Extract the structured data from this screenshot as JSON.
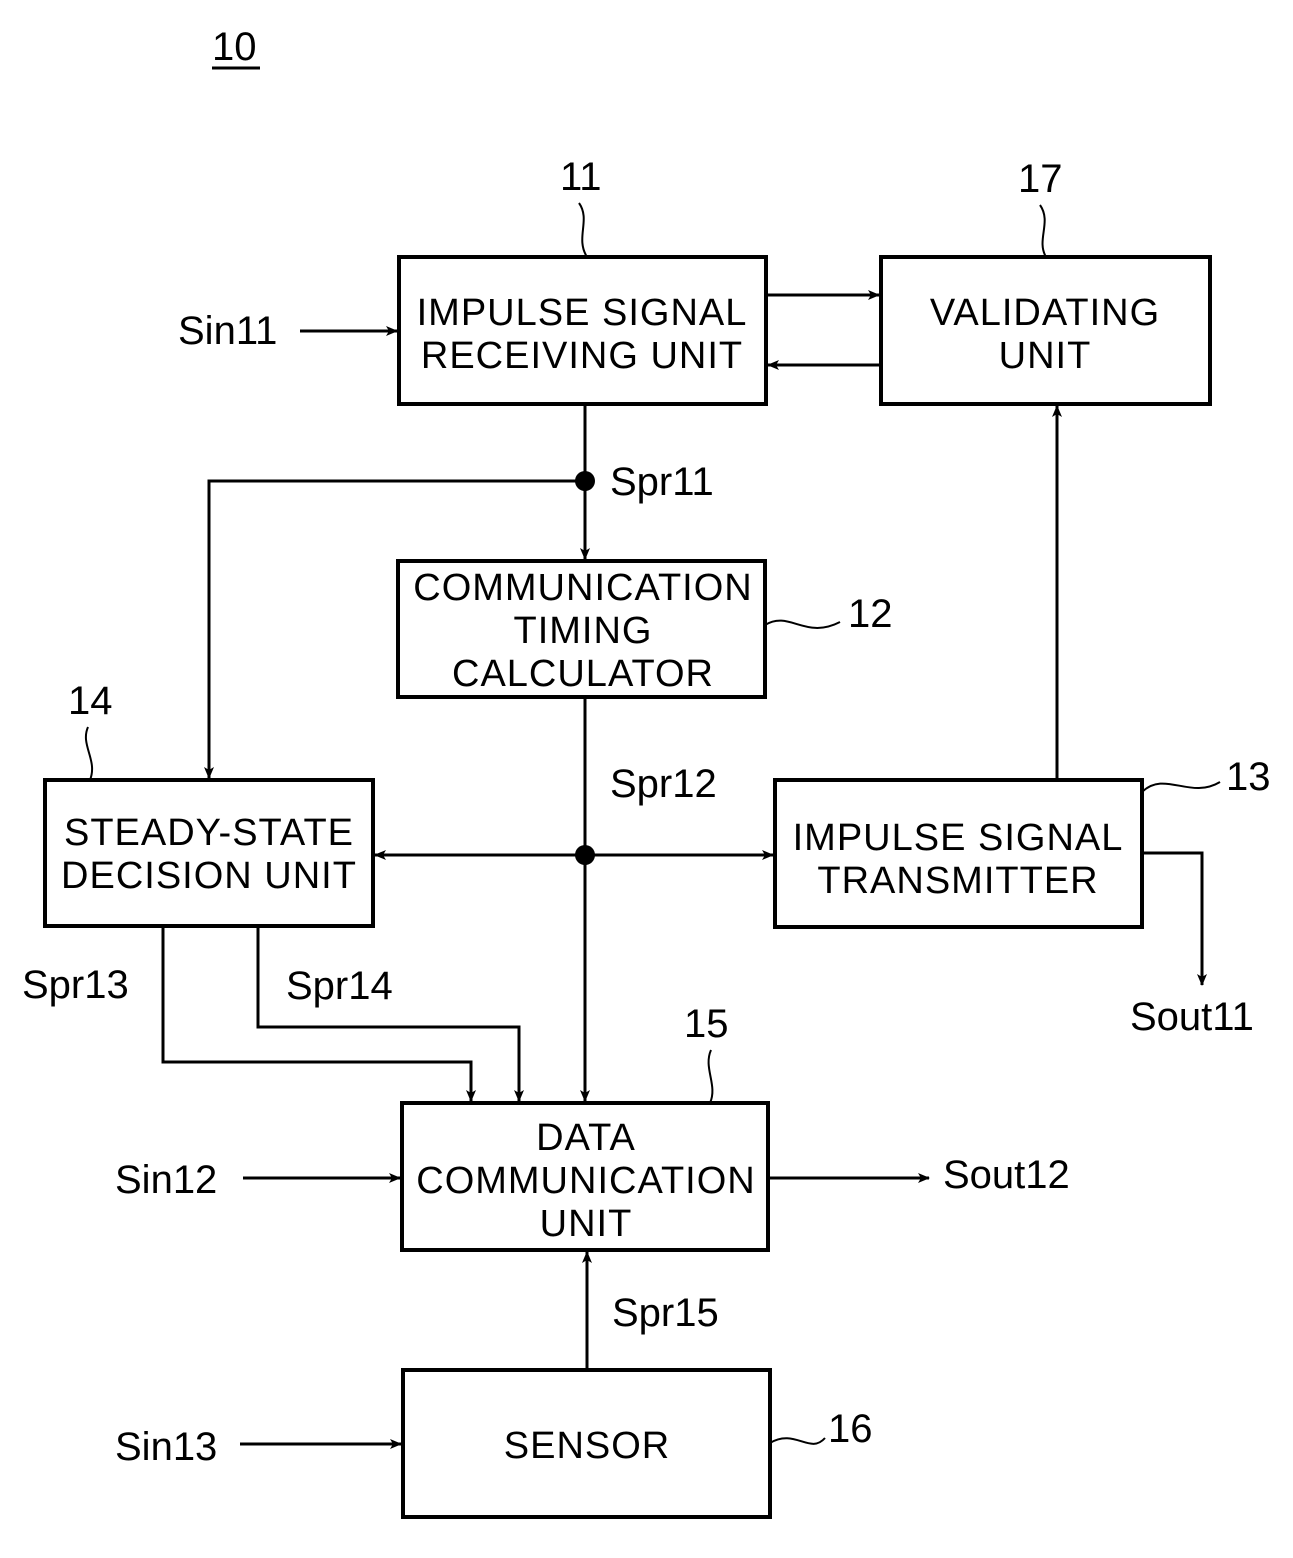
{
  "figure": {
    "number": "10",
    "line_color": "#000000",
    "background": "#ffffff"
  },
  "blocks": {
    "impulse_receiver": {
      "ref": "11",
      "lines": [
        "IMPULSE  SIGNAL",
        "RECEIVING  UNIT"
      ]
    },
    "timing_calculator": {
      "ref": "12",
      "lines": [
        "COMMUNICATION",
        "TIMING",
        "CALCULATOR"
      ]
    },
    "impulse_transmitter": {
      "ref": "13",
      "lines": [
        "IMPULSE  SIGNAL",
        "TRANSMITTER"
      ]
    },
    "steady_state": {
      "ref": "14",
      "lines": [
        "STEADY-STATE",
        "DECISION  UNIT"
      ]
    },
    "data_comm": {
      "ref": "15",
      "lines": [
        "DATA",
        "COMMUNICATION",
        "UNIT"
      ]
    },
    "sensor": {
      "ref": "16",
      "lines": [
        "SENSOR"
      ]
    },
    "validating": {
      "ref": "17",
      "lines": [
        "VALIDATING",
        "UNIT"
      ]
    }
  },
  "signals": {
    "sin11": "Sin11",
    "sin12": "Sin12",
    "sin13": "Sin13",
    "spr11": "Spr11",
    "spr12": "Spr12",
    "spr13": "Spr13",
    "spr14": "Spr14",
    "spr15": "Spr15",
    "sout11": "Sout11",
    "sout12": "Sout12"
  }
}
